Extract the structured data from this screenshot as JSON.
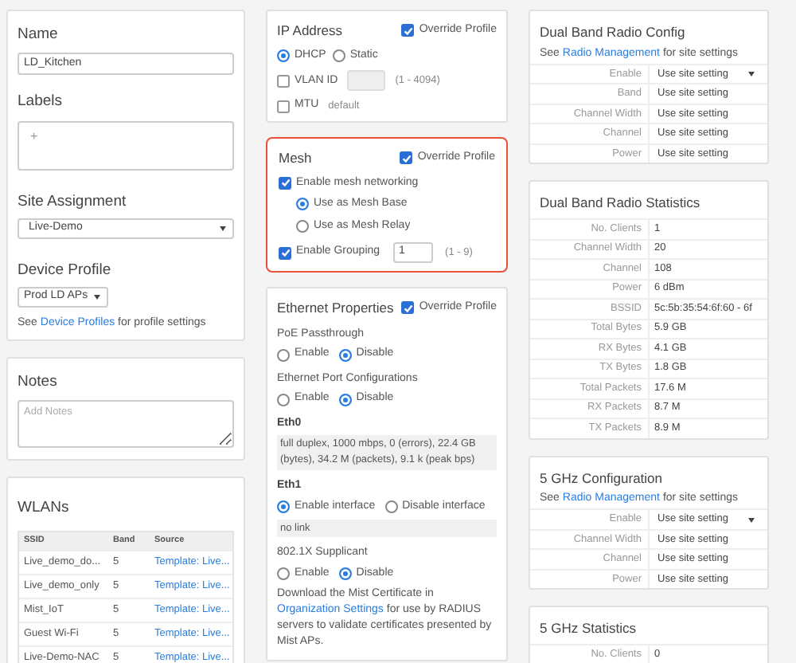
{
  "device": {
    "name_label": "Name",
    "name_value": "LD_Kitchen",
    "labels_label": "Labels",
    "labels_add": "+",
    "site_label": "Site Assignment",
    "site_value": "Live-Demo",
    "profile_label": "Device Profile",
    "profile_value": "Prod LD APs",
    "profile_hint": {
      "before": "See",
      "link": "Device Profiles",
      "after": "for profile settings"
    }
  },
  "notes": {
    "title": "Notes",
    "placeholder": "Add Notes"
  },
  "wlans": {
    "title": "WLANs",
    "columns": [
      "SSID",
      "Band",
      "Source"
    ],
    "rows": [
      [
        "Live_demo_do...",
        "5",
        "Template: Live..."
      ],
      [
        "Live_demo_only",
        "5",
        "Template: Live..."
      ],
      [
        "Mist_IoT",
        "5",
        "Template: Live..."
      ],
      [
        "Guest Wi-Fi",
        "5",
        "Template: Live..."
      ],
      [
        "Live-Demo-NAC",
        "5",
        "Template: Live..."
      ]
    ]
  },
  "ip_address": {
    "title": "IP Address",
    "override": {
      "label": "Override Profile",
      "checked": true
    },
    "modes": [
      {
        "label": "DHCP",
        "selected": true
      },
      {
        "label": "Static",
        "selected": false
      }
    ],
    "vlan": {
      "label": "VLAN ID",
      "checked": false,
      "range": "(1 - 4094)"
    },
    "mtu": {
      "label": "MTU",
      "checked": false,
      "value": "default"
    }
  },
  "mesh": {
    "title": "Mesh",
    "highlighted": true,
    "override": {
      "label": "Override Profile",
      "checked": true
    },
    "enable": {
      "label": "Enable mesh networking",
      "checked": true
    },
    "roles": [
      {
        "label": "Use as Mesh Base",
        "selected": true
      },
      {
        "label": "Use as Mesh Relay",
        "selected": false
      }
    ],
    "grouping": {
      "label": "Enable Grouping",
      "checked": true,
      "value": "1",
      "range": "(1 - 9)"
    }
  },
  "ethernet": {
    "title": "Ethernet Properties",
    "override": {
      "label": "Override Profile",
      "checked": true
    },
    "sections": [
      {
        "kind": "radio",
        "label": "PoE Passthrough",
        "options": [
          {
            "label": "Enable",
            "selected": false
          },
          {
            "label": "Disable",
            "selected": true
          }
        ]
      },
      {
        "kind": "radio",
        "label": "Ethernet Port Configurations",
        "options": [
          {
            "label": "Enable",
            "selected": false
          },
          {
            "label": "Disable",
            "selected": true
          }
        ]
      },
      {
        "kind": "status",
        "label": "Eth0",
        "text": "full duplex, 1000 mbps, 0 (errors), 22.4 GB (bytes), 34.2 M (packets), 9.1 k (peak bps)"
      },
      {
        "kind": "interface",
        "label": "Eth1",
        "options": [
          {
            "label": "Enable interface",
            "selected": true
          },
          {
            "label": "Disable interface",
            "selected": false
          }
        ],
        "text": "no link"
      },
      {
        "kind": "radio",
        "label": "802.1X Supplicant",
        "options": [
          {
            "label": "Enable",
            "selected": false
          },
          {
            "label": "Disable",
            "selected": true
          }
        ]
      },
      {
        "kind": "note",
        "before": "Download the Mist Certificate in",
        "link": "Organization Settings",
        "after": "for use by RADIUS servers to validate certificates presented by Mist APs."
      }
    ]
  },
  "right": [
    {
      "kind": "config",
      "title": "Dual Band Radio Config",
      "hint": {
        "before": "See",
        "link": "Radio Management",
        "after": "for site settings"
      },
      "rows": [
        {
          "label": "Enable",
          "value": "Use site setting",
          "dropdown": true
        },
        {
          "label": "Band",
          "value": "Use site setting",
          "dropdown": false
        },
        {
          "label": "Channel Width",
          "value": "Use site setting",
          "dropdown": false
        },
        {
          "label": "Channel",
          "value": "Use site setting",
          "dropdown": false
        },
        {
          "label": "Power",
          "value": "Use site setting",
          "dropdown": false
        }
      ]
    },
    {
      "kind": "stats",
      "title": "Dual Band Radio Statistics",
      "rows": [
        {
          "label": "No. Clients",
          "value": "1"
        },
        {
          "label": "Channel Width",
          "value": "20"
        },
        {
          "label": "Channel",
          "value": "108"
        },
        {
          "label": "Power",
          "value": "6 dBm"
        },
        {
          "label": "BSSID",
          "value": "5c:5b:35:54:6f:60 - 6f"
        },
        {
          "label": "Total Bytes",
          "value": "5.9 GB"
        },
        {
          "label": "RX Bytes",
          "value": "4.1 GB"
        },
        {
          "label": "TX Bytes",
          "value": "1.8 GB"
        },
        {
          "label": "Total Packets",
          "value": "17.6 M"
        },
        {
          "label": "RX Packets",
          "value": "8.7 M"
        },
        {
          "label": "TX Packets",
          "value": "8.9 M"
        }
      ]
    },
    {
      "kind": "config",
      "title": "5 GHz Configuration",
      "hint": {
        "before": "See",
        "link": "Radio Management",
        "after": "for site settings"
      },
      "rows": [
        {
          "label": "Enable",
          "value": "Use site setting",
          "dropdown": true
        },
        {
          "label": "Channel Width",
          "value": "Use site setting",
          "dropdown": false
        },
        {
          "label": "Channel",
          "value": "Use site setting",
          "dropdown": false
        },
        {
          "label": "Power",
          "value": "Use site setting",
          "dropdown": false
        }
      ]
    },
    {
      "kind": "stats",
      "title": "5 GHz Statistics",
      "rows": [
        {
          "label": "No. Clients",
          "value": "0"
        }
      ]
    }
  ]
}
